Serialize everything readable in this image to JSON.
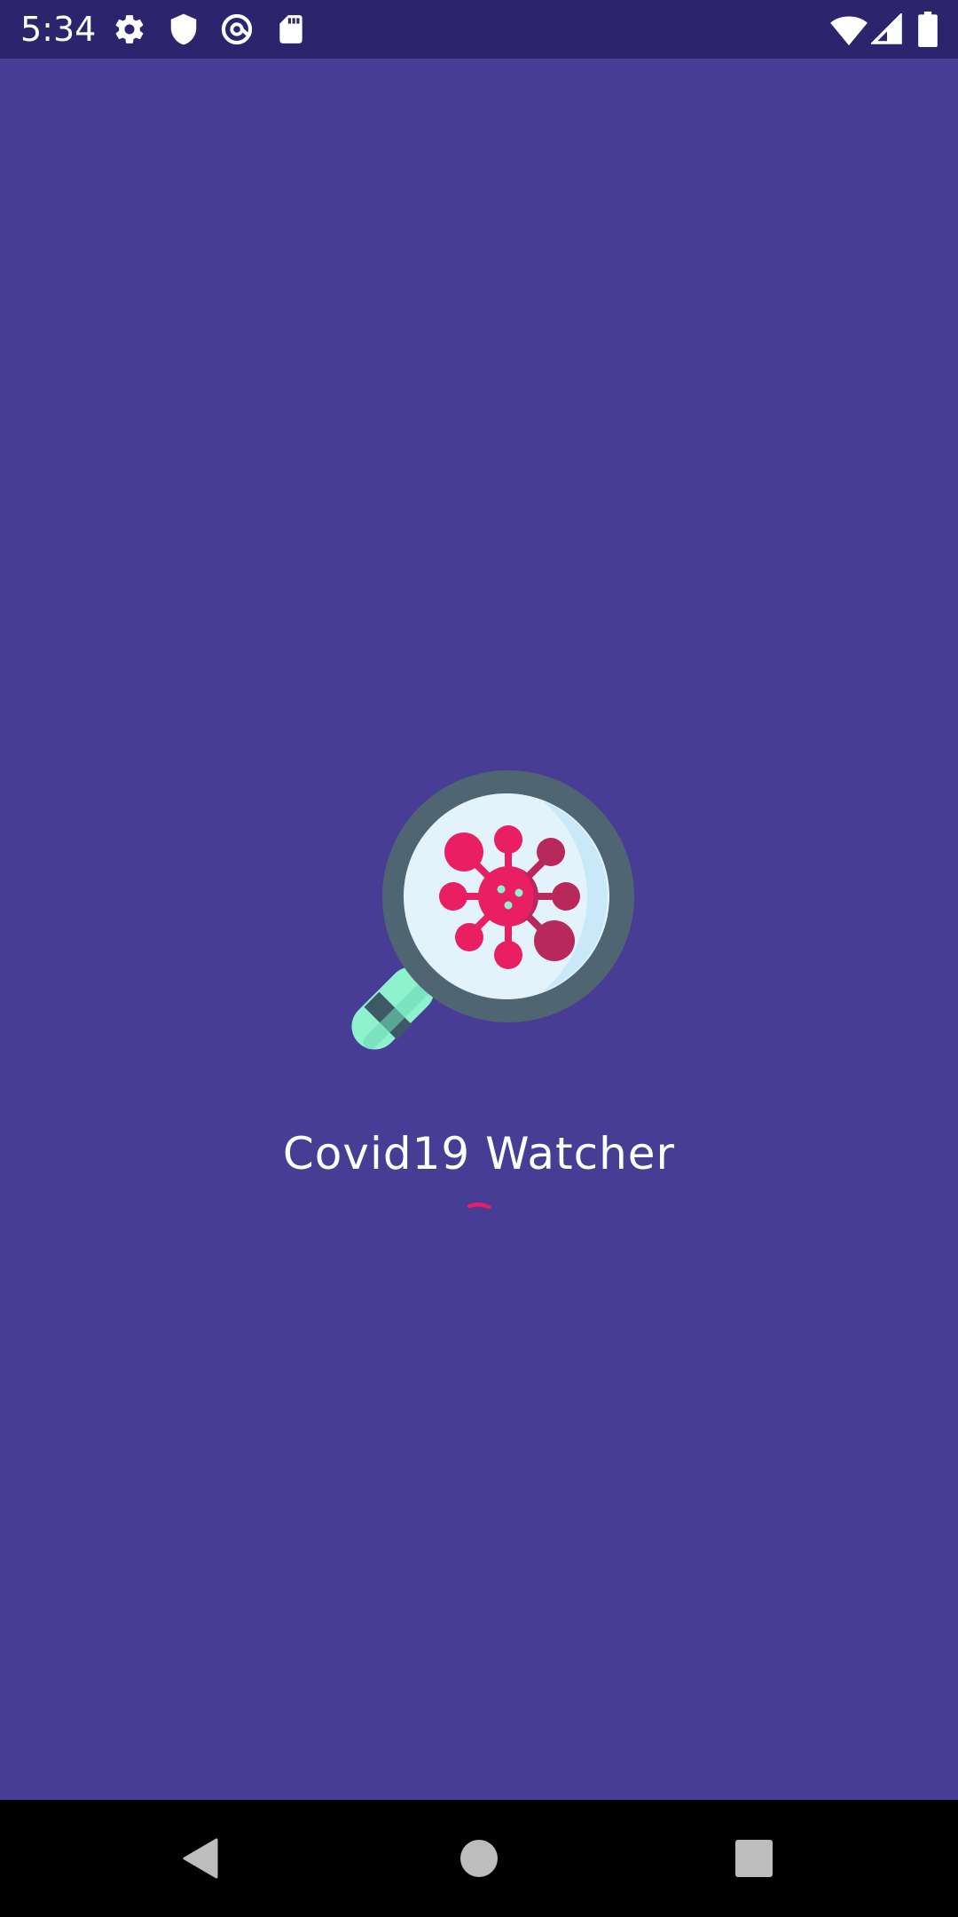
{
  "status_bar": {
    "time": "5:34",
    "left_icons": [
      "gear-icon",
      "shield-icon",
      "at-sign-icon",
      "sd-card-icon"
    ],
    "right_icons": [
      "wifi-icon",
      "cellular-signal-icon",
      "battery-icon"
    ]
  },
  "splash": {
    "title": "Covid19 Watcher",
    "logo_icon": "virus-magnifier-icon",
    "loading": true
  },
  "nav_bar": {
    "buttons": [
      "back-icon",
      "home-icon",
      "recents-icon"
    ]
  },
  "colors": {
    "background": "#473d94",
    "status_bar": "#2c246c",
    "nav_bar": "#000000",
    "accent": "#e91e63",
    "virus_dark": "#b8285a",
    "magnifier_rim": "#4f6572",
    "lens": "#e3f3fc",
    "handle_mint": "#8ef2cf"
  }
}
